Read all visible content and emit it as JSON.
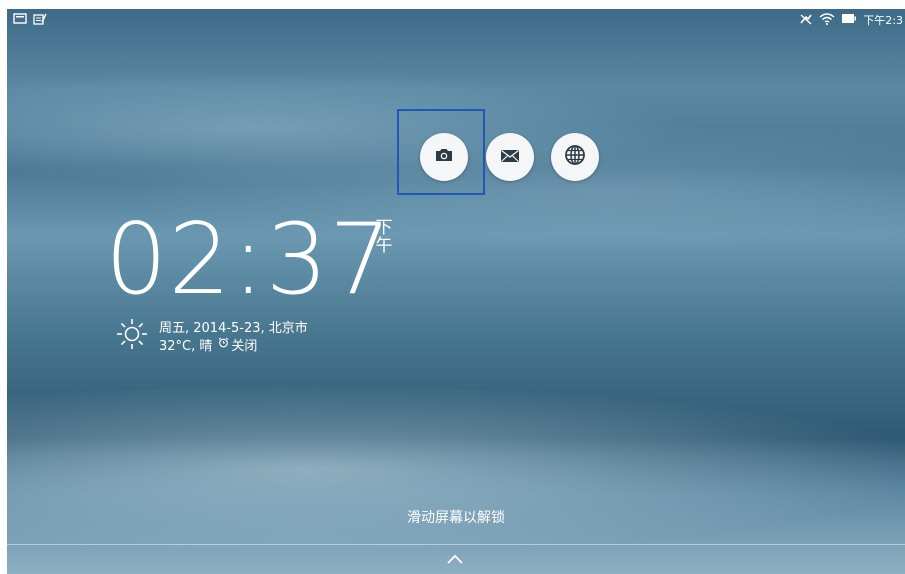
{
  "status_bar": {
    "time": "下午2:3",
    "left_icons": [
      "screenshot-icon",
      "notepad-icon"
    ],
    "right_icons": [
      "mute-icon",
      "wifi-icon",
      "battery-icon"
    ]
  },
  "shortcuts": [
    {
      "name": "camera",
      "icon": "camera-icon"
    },
    {
      "name": "email",
      "icon": "mail-icon"
    },
    {
      "name": "browser",
      "icon": "globe-icon"
    }
  ],
  "clock": {
    "time": "02:37",
    "ampm_line1": "下",
    "ampm_line2": "午"
  },
  "info": {
    "date_location": "周五, 2014-5-23, 北京市",
    "weather": "32°C, 晴",
    "alarm": "关闭"
  },
  "unlock_hint": "滑动屏幕以解锁"
}
